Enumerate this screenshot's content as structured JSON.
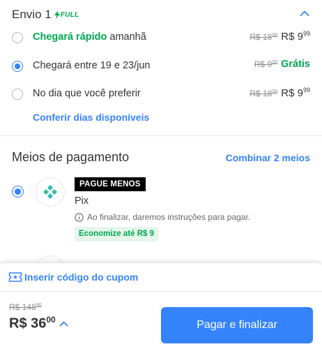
{
  "shipping": {
    "title": "Envio 1",
    "full_badge": "FULL",
    "options": [
      {
        "label_fast": "Chegará rápido",
        "label_rest": " amanhã",
        "old_price_int": "R$ 18",
        "old_price_cents": "00",
        "price_int": "R$ 9",
        "price_cents": "99",
        "selected": false
      },
      {
        "label": "Chegará entre 19 e 23/jun",
        "old_price_int": "R$ 9",
        "old_price_cents": "00",
        "free_label": "Grátis",
        "selected": true
      },
      {
        "label": "No dia que você preferir",
        "old_price_int": "R$ 18",
        "old_price_cents": "00",
        "price_int": "R$ 9",
        "price_cents": "99",
        "selected": false
      }
    ],
    "check_days_link": "Conferir dias disponíveis"
  },
  "payment": {
    "title": "Meios de pagamento",
    "combine_link": "Combinar 2 meios",
    "method": {
      "tag": "PAGUE MENOS",
      "name": "Pix",
      "info": "Ao finalizar, daremos instruções para pagar.",
      "savings": "Economize até R$ 9",
      "selected": true
    }
  },
  "footer": {
    "coupon_label": "Inserir código do cupom",
    "total_old_int": "R$ 148",
    "total_old_cents": "90",
    "total_int": "R$ 36",
    "total_cents": "00",
    "pay_button": "Pagar e finalizar"
  },
  "colors": {
    "primary": "#3483fa",
    "green": "#00a650",
    "savings_bg": "#e5f6ec",
    "text": "#333333",
    "muted": "#8c8c8c"
  }
}
